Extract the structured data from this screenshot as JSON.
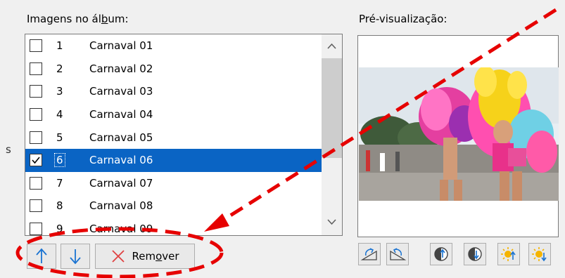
{
  "album_label": "Imagens no álbum:",
  "preview_label": "Pré-visualização:",
  "left_stub": "s",
  "images": [
    {
      "num": "1",
      "name": "Carnaval 01",
      "checked": false,
      "selected": false
    },
    {
      "num": "2",
      "name": "Carnaval 02",
      "checked": false,
      "selected": false
    },
    {
      "num": "3",
      "name": "Carnaval 03",
      "checked": false,
      "selected": false
    },
    {
      "num": "4",
      "name": "Carnaval 04",
      "checked": false,
      "selected": false
    },
    {
      "num": "5",
      "name": "Carnaval 05",
      "checked": false,
      "selected": false
    },
    {
      "num": "6",
      "name": "Carnaval 06",
      "checked": true,
      "selected": true
    },
    {
      "num": "7",
      "name": "Carnaval 07",
      "checked": false,
      "selected": false
    },
    {
      "num": "8",
      "name": "Carnaval 08",
      "checked": false,
      "selected": false
    },
    {
      "num": "9",
      "name": "Carnaval 09",
      "checked": false,
      "selected": false
    }
  ],
  "buttons": {
    "move_up_icon": "arrow-up-icon",
    "move_down_icon": "arrow-down-icon",
    "remove_label": "Remover",
    "remove_icon": "x-icon"
  },
  "preview_tools": [
    "rotate-left-icon",
    "rotate-right-icon",
    "contrast-up-icon",
    "contrast-down-icon",
    "brightness-up-icon",
    "brightness-down-icon"
  ],
  "colors": {
    "selection": "#0a64c4",
    "accent_blue": "#1a73d1",
    "annotation_red": "#e60000"
  }
}
